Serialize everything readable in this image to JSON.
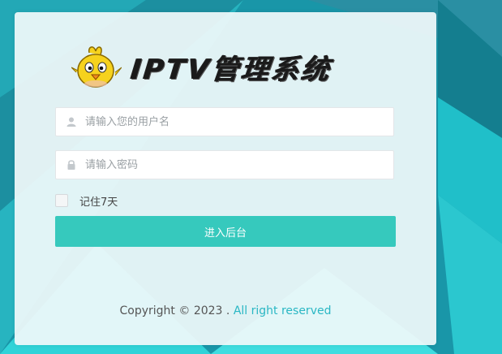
{
  "brand": {
    "title": "IPTV管理系统"
  },
  "login": {
    "username_placeholder": "请输入您的用户名",
    "password_placeholder": "请输入密码",
    "remember_label": "记住7天",
    "remember_checked": false,
    "submit_label": "进入后台"
  },
  "footer": {
    "copyright": "Copyright © 2023 .",
    "rights": "All right reserved"
  },
  "icons": {
    "user": "user-icon",
    "lock": "lock-icon",
    "mascot": "chick-mascot-icon"
  },
  "colors": {
    "accent": "#36c9bd",
    "link": "#2ab7c4",
    "background": "#1b9fb0"
  }
}
